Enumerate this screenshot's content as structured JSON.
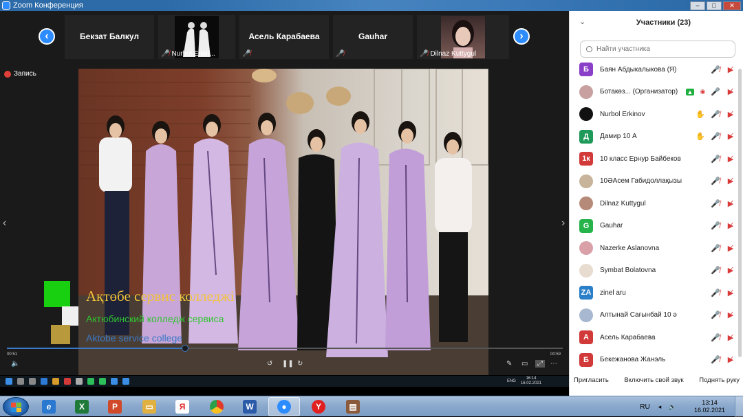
{
  "window": {
    "title": "Zoom Конференция"
  },
  "gallery": {
    "tiles": [
      {
        "name": "Бекзат Балкул"
      },
      {
        "label": "Nurbol Erkin..."
      },
      {
        "name": "Асель Карабаева"
      },
      {
        "name": "Gauhar"
      },
      {
        "label": "Dilnaz Kuttygul"
      }
    ]
  },
  "recording": {
    "label": "Запись"
  },
  "video": {
    "caption_main": "Ақтөбе сервис колледжі",
    "caption_ru": "Актюбинский колледж сервиса",
    "caption_en": "Aktobe service college",
    "time_left": "00:51",
    "time_right": "00:59",
    "progress": 0.32
  },
  "inner_taskbar": {
    "lang": "ENG",
    "time": "16:14",
    "date": "16.02.2021"
  },
  "participants": {
    "title": "Участники (23)",
    "search_placeholder": "Найти участника",
    "list": [
      {
        "initial": "Б",
        "color": "#8a3fc8",
        "name": "Баян Абдыкалыкова (Я)",
        "icons": [
          "mic-off",
          "cam-off"
        ]
      },
      {
        "initial": "",
        "color": "#c9a0a0",
        "name": "Ботакөз... (Организатор)",
        "icons": [
          "share",
          "rec",
          "mic-on",
          "cam-off"
        ]
      },
      {
        "initial": "",
        "color": "#111111",
        "name": "Nurbol Erkinov",
        "icons": [
          "hand",
          "mic-off",
          "cam-off"
        ]
      },
      {
        "initial": "Д",
        "color": "#1f9a5a",
        "name": "Дамир 10 А",
        "icons": [
          "hand",
          "mic-off",
          "cam-off"
        ]
      },
      {
        "initial": "1к",
        "color": "#d23a3a",
        "name": "10 класс Ернур Байбеков",
        "icons": [
          "mic-off",
          "cam-off"
        ]
      },
      {
        "initial": "",
        "color": "#c8b49a",
        "name": "10ӘАсем Габидоллақызы",
        "icons": [
          "mic-off",
          "cam-off"
        ]
      },
      {
        "initial": "",
        "color": "#b68a78",
        "name": "Dilnaz Kuttygul",
        "icons": [
          "mic-off",
          "cam-off"
        ]
      },
      {
        "initial": "G",
        "color": "#25b34a",
        "name": "Gauhar",
        "icons": [
          "mic-off",
          "cam-off"
        ]
      },
      {
        "initial": "",
        "color": "#d9a0a8",
        "name": "Nazerke Aslanovna",
        "icons": [
          "mic-off",
          "cam-off"
        ]
      },
      {
        "initial": "",
        "color": "#e8dcd0",
        "name": "Symbat Bolatovna",
        "icons": [
          "mic-off",
          "cam-off"
        ]
      },
      {
        "initial": "ZA",
        "color": "#2a7fc8",
        "name": "zinel aru",
        "icons": [
          "mic-off",
          "cam-off"
        ]
      },
      {
        "initial": "",
        "color": "#a8b8d0",
        "name": "Алтынай Сағынбай 10 ә",
        "icons": [
          "mic-off",
          "cam-off"
        ]
      },
      {
        "initial": "А",
        "color": "#d23a3a",
        "name": "Асель Карабаева",
        "icons": [
          "mic-off",
          "cam-off"
        ]
      },
      {
        "initial": "Б",
        "color": "#d23a3a",
        "name": "Бекежанова Жанэль",
        "icons": [
          "mic-off",
          "cam-off"
        ]
      }
    ],
    "footer": {
      "invite": "Пригласить",
      "unmute": "Включить свой звук",
      "raise_hand": "Поднять руку"
    }
  },
  "taskbar": {
    "apps": [
      "ie",
      "excel",
      "powerpoint",
      "explorer",
      "yandex-browser",
      "chrome",
      "word",
      "zoom",
      "yandex",
      "winrar"
    ],
    "lang": "RU",
    "time": "13:14",
    "date": "16.02.2021"
  }
}
